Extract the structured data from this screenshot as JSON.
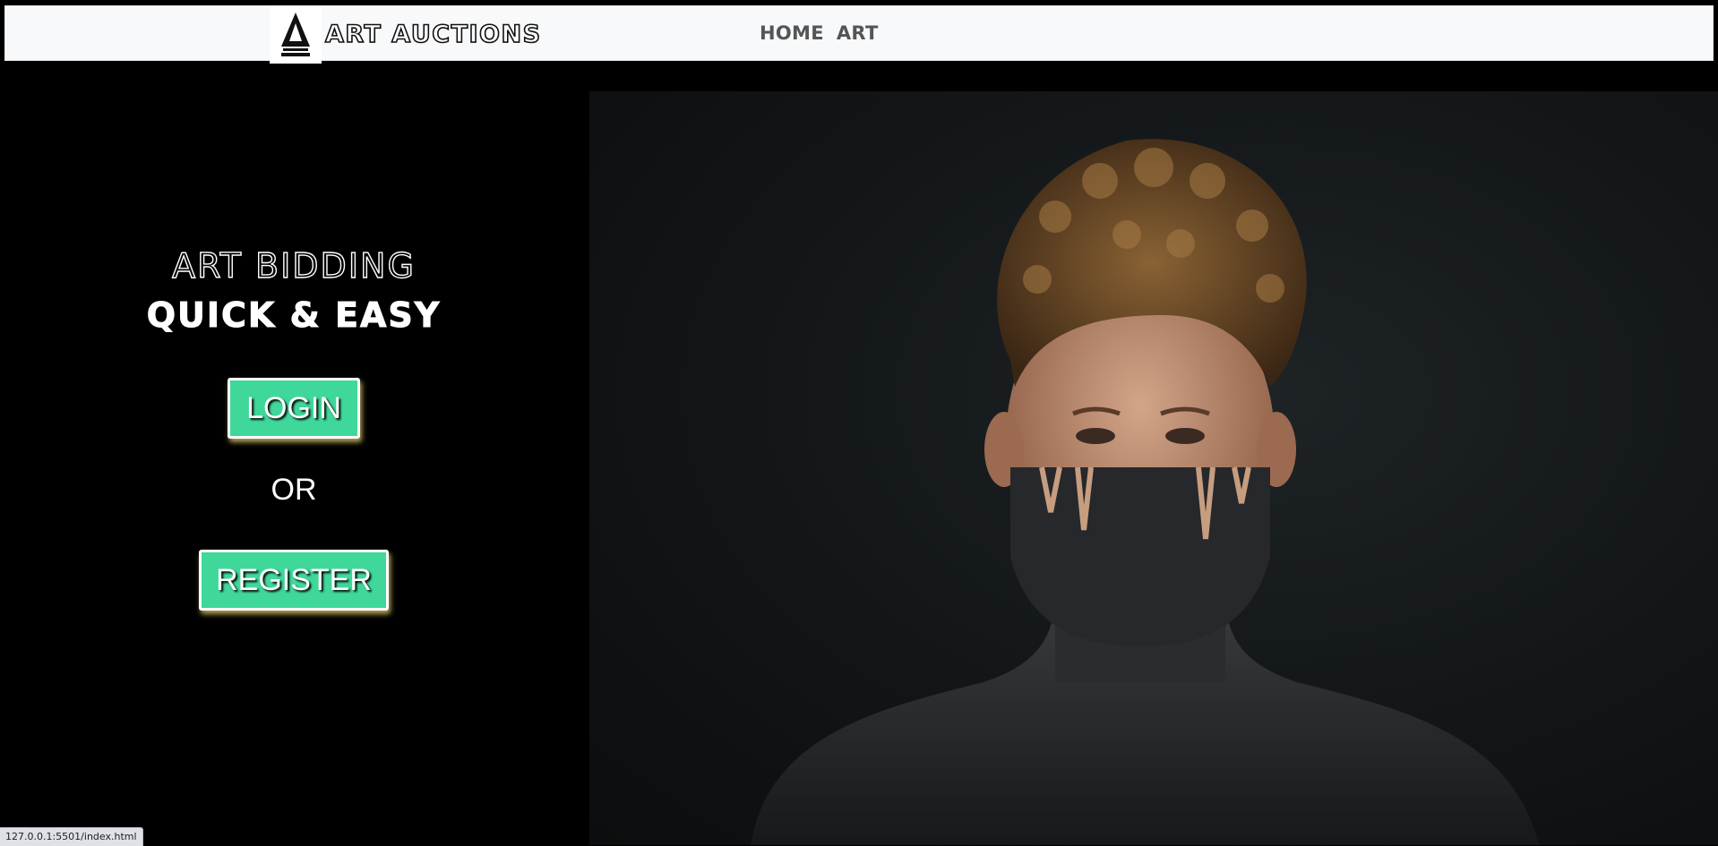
{
  "navbar": {
    "brand_text": "ART AUCTIONS",
    "links": [
      "HOME",
      "ART"
    ]
  },
  "hero": {
    "headline_line1": "ART BIDDING",
    "headline_line2": "QUICK & EASY",
    "login_label": "LOGIN",
    "or_label": "OR",
    "register_label": "REGISTER",
    "button_color": "#3fd89a"
  },
  "status_bar": {
    "url": "127.0.0.1:5501/index.html"
  }
}
